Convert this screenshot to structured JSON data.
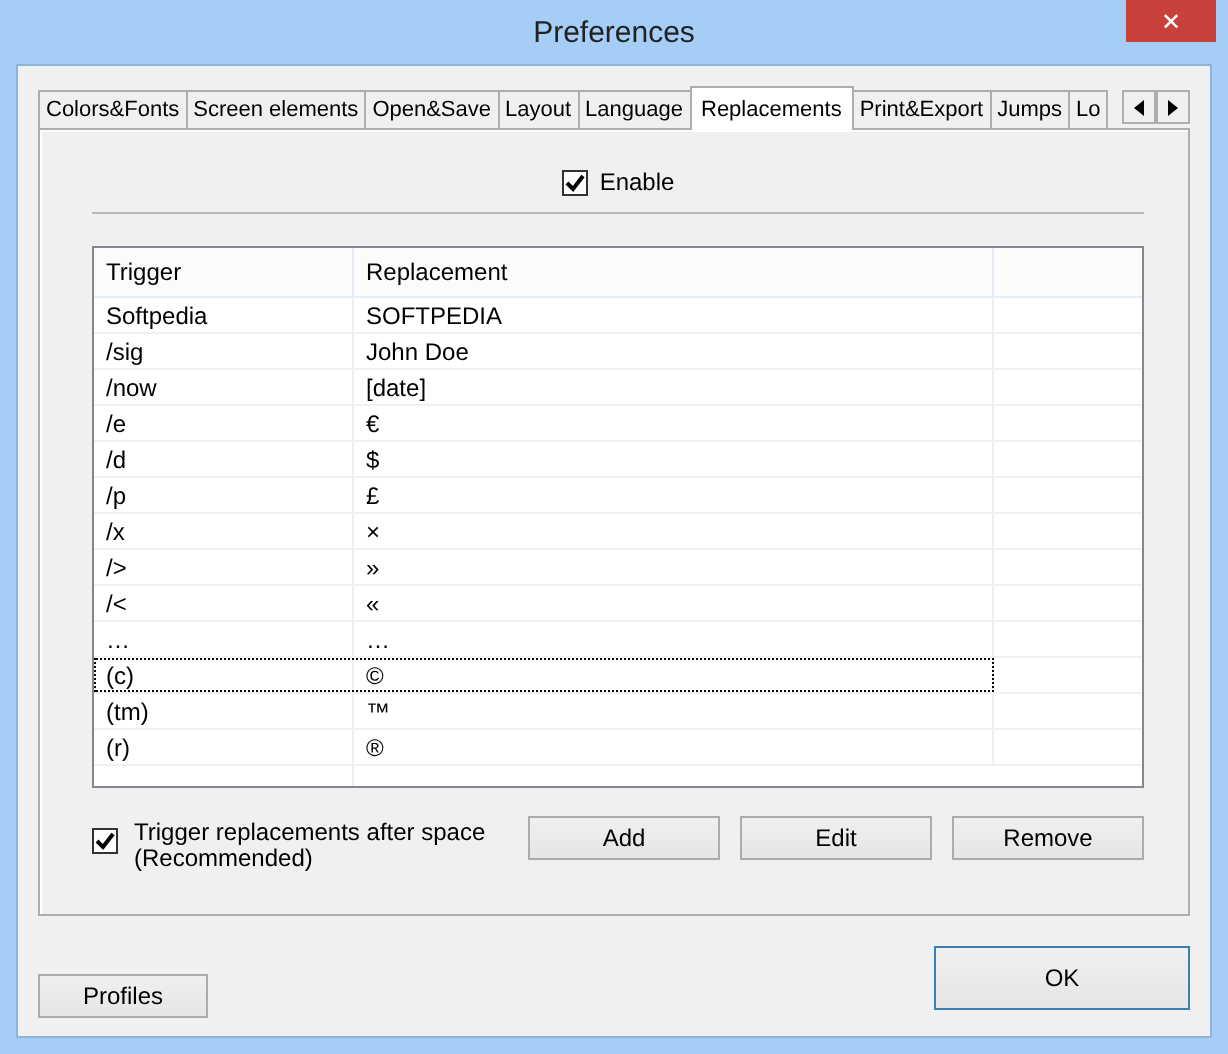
{
  "window": {
    "title": "Preferences",
    "close": "✕"
  },
  "tabs": [
    {
      "label": "Colors&Fonts",
      "selected": false
    },
    {
      "label": "Screen elements",
      "selected": false
    },
    {
      "label": "Open&Save",
      "selected": false
    },
    {
      "label": "Layout",
      "selected": false
    },
    {
      "label": "Language",
      "selected": false
    },
    {
      "label": "Replacements",
      "selected": true
    },
    {
      "label": "Print&Export",
      "selected": false
    },
    {
      "label": "Jumps",
      "selected": false
    },
    {
      "label": "Lo",
      "selected": false
    }
  ],
  "enable": {
    "label": "Enable",
    "checked": true
  },
  "table": {
    "columns": [
      "Trigger",
      "Replacement"
    ],
    "rows": [
      {
        "trigger": "Softpedia",
        "replacement": "SOFTPEDIA",
        "focused": false
      },
      {
        "trigger": "/sig",
        "replacement": "John Doe",
        "focused": false
      },
      {
        "trigger": "/now",
        "replacement": "[date]",
        "focused": false
      },
      {
        "trigger": "/e",
        "replacement": "€",
        "focused": false
      },
      {
        "trigger": "/d",
        "replacement": "$",
        "focused": false
      },
      {
        "trigger": "/p",
        "replacement": "£",
        "focused": false
      },
      {
        "trigger": "/x",
        "replacement": "×",
        "focused": false
      },
      {
        "trigger": "/>",
        "replacement": "»",
        "focused": false
      },
      {
        "trigger": "/<",
        "replacement": "«",
        "focused": false
      },
      {
        "trigger": "…",
        "replacement": "…",
        "focused": false
      },
      {
        "trigger": "(c)",
        "replacement": "©",
        "focused": true
      },
      {
        "trigger": "(tm)",
        "replacement": "™",
        "focused": false
      },
      {
        "trigger": "(r)",
        "replacement": "®",
        "focused": false
      }
    ]
  },
  "after_space": {
    "label": "Trigger replacements after space (Recommended)",
    "checked": true
  },
  "row_buttons": [
    "Add",
    "Edit",
    "Remove"
  ],
  "profiles_button": "Profiles",
  "ok_button": "OK"
}
